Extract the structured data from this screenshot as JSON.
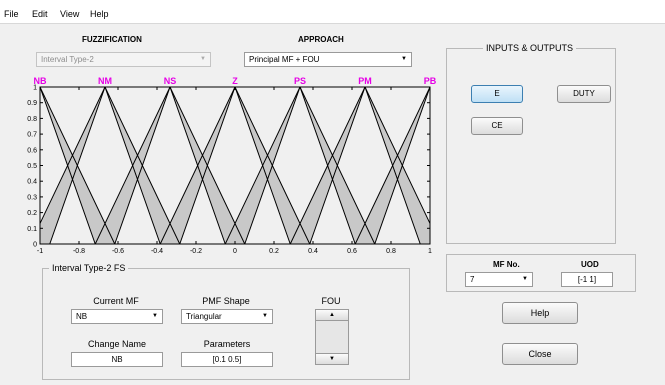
{
  "menu": {
    "file": "File",
    "edit": "Edit",
    "view": "View",
    "help": "Help"
  },
  "fuzzification": {
    "title": "FUZZIFICATION",
    "value": "Interval Type-2"
  },
  "approach": {
    "title": "APPROACH",
    "value": "Principal MF + FOU"
  },
  "chart_data": {
    "type": "line",
    "title": "",
    "xlabel": "",
    "ylabel": "",
    "xlim": [
      -1,
      1
    ],
    "ylim": [
      0,
      1
    ],
    "x_ticks": [
      "-1",
      "-0.8",
      "-0.6",
      "-0.4",
      "-0.2",
      "0",
      "0.2",
      "0.4",
      "0.6",
      "0.8",
      "1"
    ],
    "y_ticks": [
      "0",
      "0.1",
      "0.2",
      "0.3",
      "0.4",
      "0.5",
      "0.6",
      "0.7",
      "0.8",
      "0.9",
      "1"
    ],
    "grid": false,
    "mf_labels": [
      "NB",
      "NM",
      "NS",
      "Z",
      "PS",
      "PM",
      "PB"
    ],
    "mf_label_color": "#e600e6",
    "mf_centers": [
      -1,
      -0.6667,
      -0.3333,
      0,
      0.3333,
      0.6667,
      1
    ],
    "mf_half_width": 0.3333,
    "fou_spread": 0.05,
    "fou_color": "#c8c8c8"
  },
  "inputs_outputs": {
    "title": "INPUTS & OUTPUTS",
    "e": "E",
    "duty": "DUTY",
    "ce": "CE"
  },
  "mf_no": {
    "label": "MF No.",
    "value": "7"
  },
  "uod": {
    "label": "UOD",
    "value": "[-1  1]"
  },
  "it2fs": {
    "title": "Interval Type-2 FS",
    "current_mf_label": "Current MF",
    "current_mf_value": "NB",
    "pmf_shape_label": "PMF Shape",
    "pmf_shape_value": "Triangular",
    "fou_label": "FOU",
    "change_name_label": "Change Name",
    "change_name_value": "NB",
    "parameters_label": "Parameters",
    "parameters_value": "[0.1 0.5]"
  },
  "buttons": {
    "help": "Help",
    "close": "Close"
  }
}
